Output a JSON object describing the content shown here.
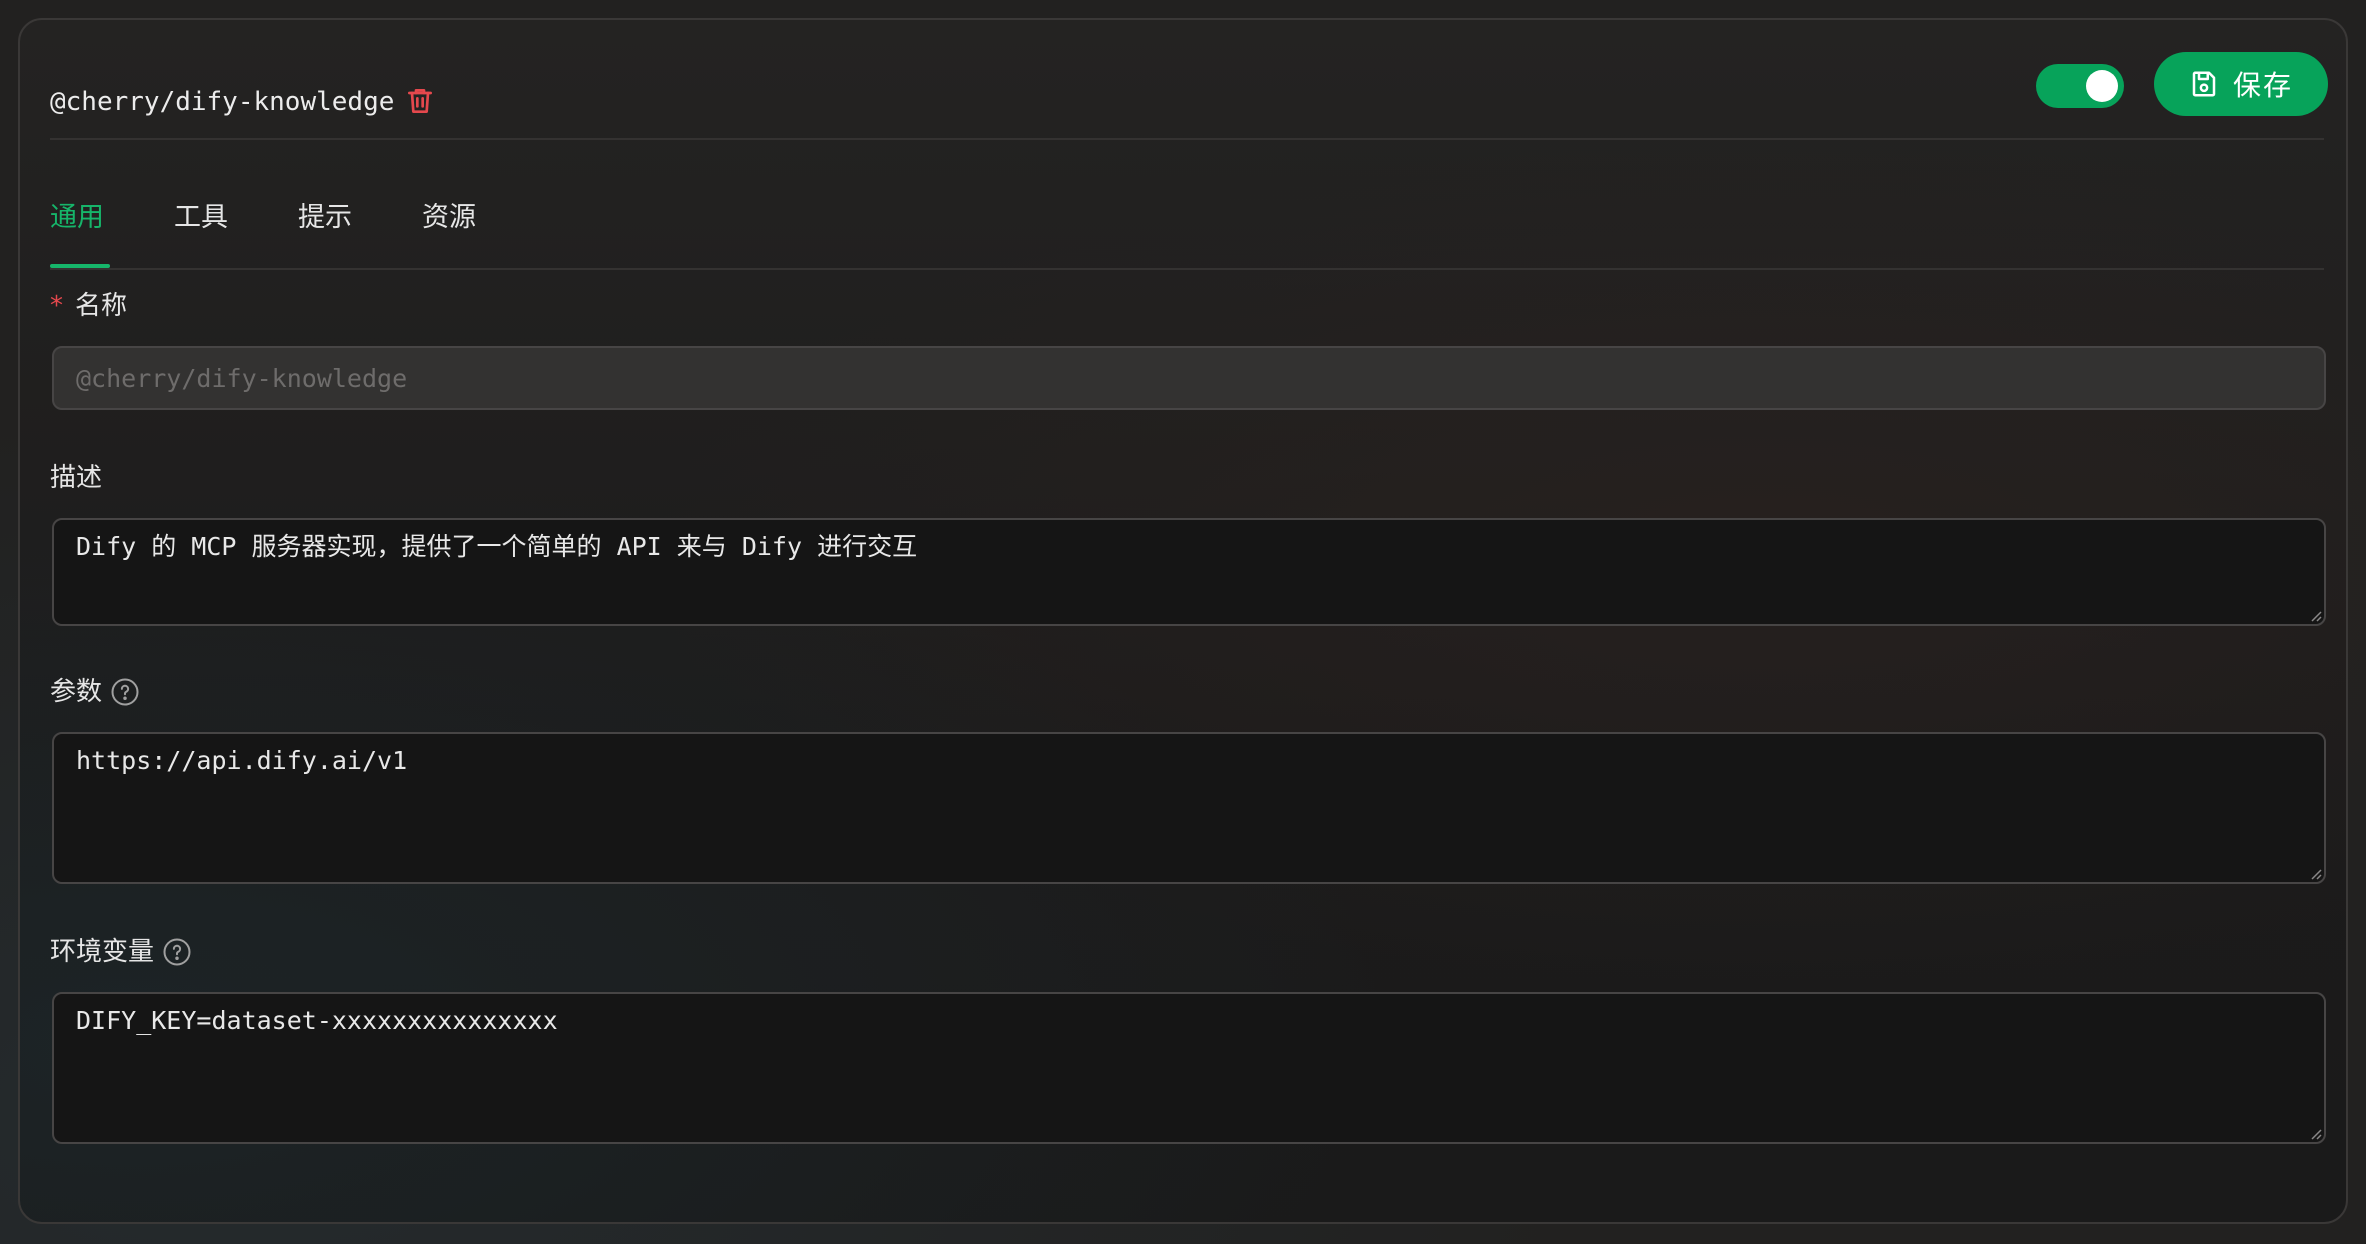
{
  "header": {
    "server_name": "@cherry/dify-knowledge",
    "enabled": true,
    "save_label": "保存"
  },
  "tabs": [
    {
      "label": "通用",
      "active": true
    },
    {
      "label": "工具",
      "active": false
    },
    {
      "label": "提示",
      "active": false
    },
    {
      "label": "资源",
      "active": false
    }
  ],
  "form": {
    "name": {
      "label": "名称",
      "required_mark": "*",
      "placeholder": "@cherry/dify-knowledge"
    },
    "description": {
      "label": "描述",
      "value": "Dify 的 MCP 服务器实现，提供了一个简单的 API 来与 Dify 进行交互"
    },
    "args": {
      "label": "参数",
      "value": "https://api.dify.ai/v1"
    },
    "env": {
      "label": "环境变量",
      "value": "DIFY_KEY=dataset-xxxxxxxxxxxxxxx"
    }
  },
  "colors": {
    "accent": "#07a35a",
    "active_tab": "#16b56a",
    "danger": "#e5484d",
    "panel_bg": "#1c1b1b"
  }
}
